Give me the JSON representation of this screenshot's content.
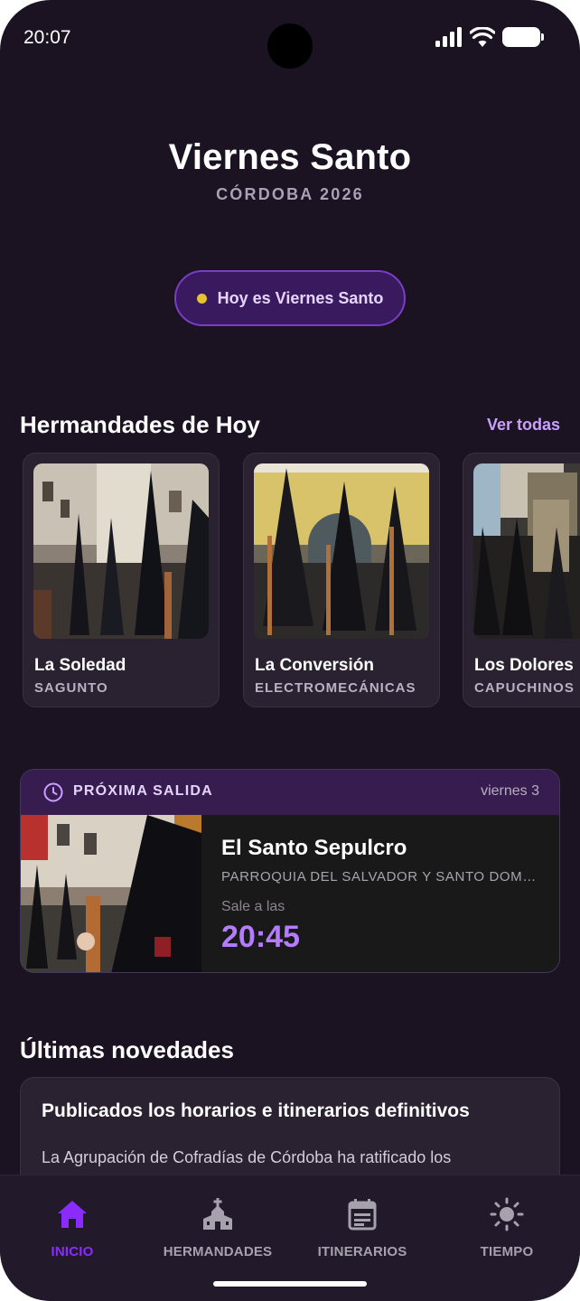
{
  "status_bar": {
    "time": "20:07"
  },
  "header": {
    "title": "Viernes Santo",
    "subtitle": "CÓRDOBA 2026"
  },
  "today_badge": {
    "label": "Hoy es Viernes Santo",
    "dot_color": "#e7c331"
  },
  "brotherhoods_section": {
    "title": "Hermandades de Hoy",
    "see_all": "Ver todas",
    "items": [
      {
        "name": "La Soledad",
        "location": "SAGUNTO"
      },
      {
        "name": "La Conversión",
        "location": "ELECTROMECÁNICAS"
      },
      {
        "name": "Los Dolores",
        "location": "CAPUCHINOS"
      }
    ]
  },
  "next_departure": {
    "label": "PRÓXIMA SALIDA",
    "date": "viernes 3",
    "name": "El Santo Sepulcro",
    "church": "PARROQUIA DEL SALVADOR Y SANTO DOMINGO DE SILOS",
    "departs_label": "Sale a las",
    "time": "20:45",
    "accent_color": "#b57cff"
  },
  "news_section": {
    "title": "Últimas novedades",
    "items": [
      {
        "title": "Publicados los horarios e itinerarios definitivos",
        "body": "La Agrupación de Cofradías de Córdoba ha ratificado los"
      }
    ]
  },
  "bottom_nav": {
    "items": [
      {
        "label": "INICIO",
        "icon": "home-icon",
        "active": true
      },
      {
        "label": "HERMANDADES",
        "icon": "church-icon",
        "active": false
      },
      {
        "label": "ITINERARIOS",
        "icon": "calendar-icon",
        "active": false
      },
      {
        "label": "TIEMPO",
        "icon": "sun-icon",
        "active": false
      }
    ],
    "active_color": "#8a2bff"
  }
}
